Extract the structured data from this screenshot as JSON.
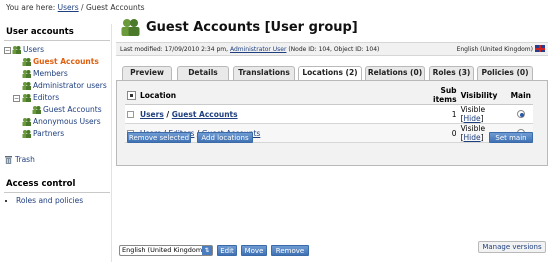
{
  "breadcrumb": {
    "prefix": "You are here:",
    "users": "Users",
    "separator": " / ",
    "current": "Guest Accounts"
  },
  "sidebar": {
    "title": "User accounts",
    "tree": [
      {
        "label": "Users",
        "level": 0
      },
      {
        "label": "Guest Accounts",
        "level": 1,
        "current": true
      },
      {
        "label": "Members",
        "level": 1
      },
      {
        "label": "Administrator users",
        "level": 1
      },
      {
        "label": "Editors",
        "level": 1
      },
      {
        "label": "Guest Accounts",
        "level": 2
      },
      {
        "label": "Anonymous Users",
        "level": 1
      },
      {
        "label": "Partners",
        "level": 1
      }
    ],
    "trash": "Trash",
    "access_title": "Access control",
    "access_items": [
      "Roles and policies"
    ]
  },
  "header": {
    "title": "Guest Accounts [User group]",
    "meta_prefix": "Last modified: 17/09/2010 2:34 pm, ",
    "meta_user": "Administrator User",
    "meta_suffix": " (Node ID: 104, Object ID: 104)",
    "language": "English (United Kingdom)"
  },
  "tabs": [
    {
      "label": "Preview"
    },
    {
      "label": "Details"
    },
    {
      "label": "Translations (1)"
    },
    {
      "label": "Locations (2)",
      "active": true
    },
    {
      "label": "Relations (0)"
    },
    {
      "label": "Roles (3)"
    },
    {
      "label": "Policies (0)"
    }
  ],
  "locations": {
    "headers": {
      "location": "Location",
      "sub_items": "Sub items",
      "visibility": "Visibility",
      "main": "Main"
    },
    "rows": [
      {
        "path": [
          "Users",
          "Guest Accounts"
        ],
        "sub_items": "1",
        "visibility": "Visible",
        "hide": "Hide",
        "main": true,
        "bold": true
      },
      {
        "path": [
          "Users",
          "Editors",
          "Guest Accounts"
        ],
        "sub_items": "0",
        "visibility": "Visible",
        "hide": "Hide",
        "main": false,
        "bold": false
      }
    ],
    "buttons": {
      "remove": "Remove selected",
      "add": "Add locations",
      "set_main": "Set main"
    }
  },
  "footer": {
    "language_select": "English (United Kingdom)",
    "edit": "Edit",
    "move": "Move",
    "remove": "Remove",
    "manage_versions": "Manage versions"
  },
  "colors": {
    "accent_blue": "#3f72b4",
    "current_orange": "#e06010",
    "link": "#1f3f7f"
  }
}
